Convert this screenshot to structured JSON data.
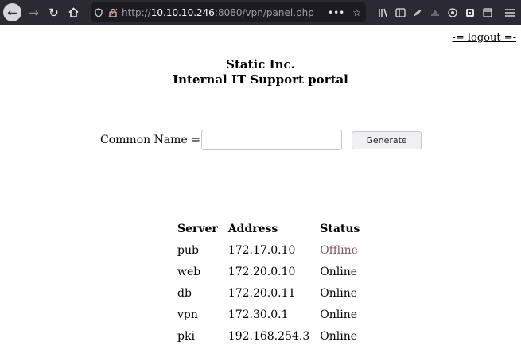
{
  "browser": {
    "url_proto": "http://",
    "url_host": "10.10.10.246",
    "url_path": ":8080/vpn/panel.php",
    "page_actions_label": "•••"
  },
  "page": {
    "logout": "-= logout =-",
    "title_line1": "Static Inc.",
    "title_line2": "Internal IT Support portal",
    "form": {
      "label": "Common Name =",
      "input_value": "",
      "button": "Generate"
    },
    "table": {
      "headers": [
        "Server",
        "Address",
        "Status"
      ],
      "rows": [
        [
          "pub",
          "172.17.0.10",
          "Offline"
        ],
        [
          "web",
          "172.20.0.10",
          "Online"
        ],
        [
          "db",
          "172.20.0.11",
          "Online"
        ],
        [
          "vpn",
          "172.30.0.1",
          "Online"
        ],
        [
          "pki",
          "192.168.254.3",
          "Online"
        ]
      ]
    }
  },
  "colors": {
    "toolbar_bg": "#2b2a33",
    "urlbar_bg": "#1c1b22",
    "offline_text": "#7a5a5a"
  }
}
